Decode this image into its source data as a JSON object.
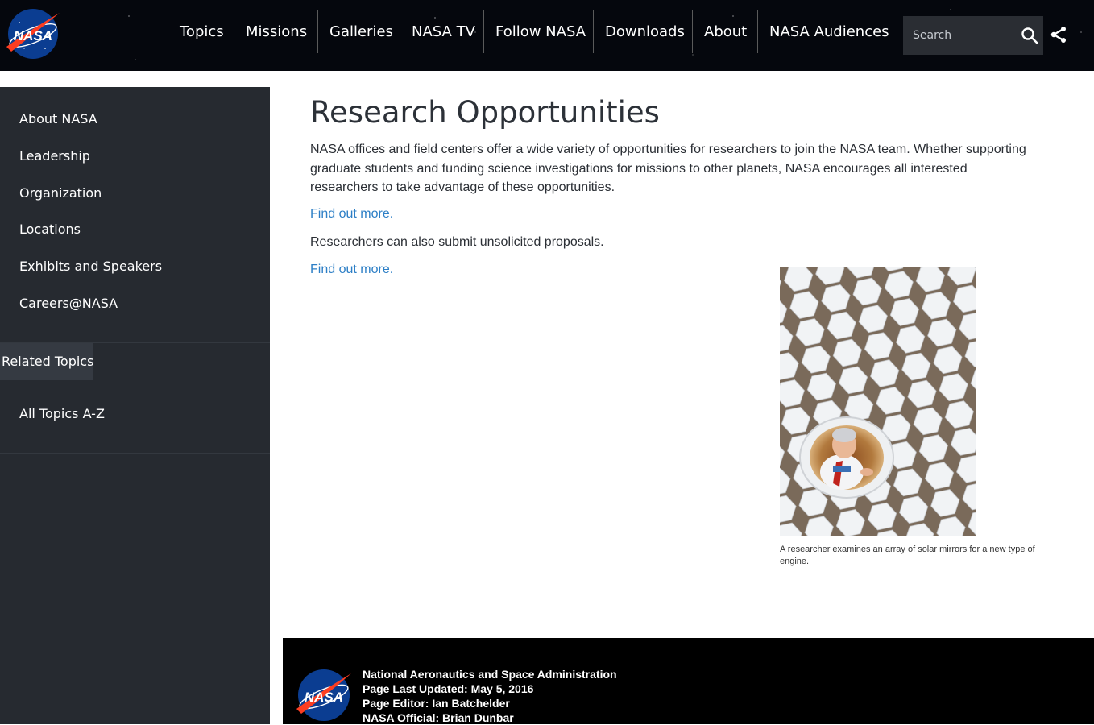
{
  "header": {
    "logo_text": "NASA",
    "nav": [
      {
        "label": "Topics"
      },
      {
        "label": "Missions"
      },
      {
        "label": "Galleries"
      },
      {
        "label": "NASA TV"
      },
      {
        "label": "Follow NASA"
      },
      {
        "label": "Downloads"
      },
      {
        "label": "About"
      },
      {
        "label": "NASA Audiences"
      }
    ],
    "search": {
      "placeholder": "Search",
      "icon": "search-icon"
    },
    "share_icon": "share-icon"
  },
  "sidebar": {
    "items": [
      {
        "label": "About NASA"
      },
      {
        "label": "Leadership"
      },
      {
        "label": "Organization"
      },
      {
        "label": "Locations"
      },
      {
        "label": "Exhibits and Speakers"
      },
      {
        "label": "Careers@NASA"
      }
    ],
    "related": {
      "title": "Related Topics",
      "items": [
        {
          "label": "All Topics A-Z"
        }
      ]
    }
  },
  "main": {
    "title": "Research Opportunities",
    "intro": "NASA offices and field centers offer a wide variety of opportunities for researchers to join the NASA team. Whether supporting graduate students and funding science investigations for missions to other planets, NASA encourages all interested researchers to take advantage of these opportunities.",
    "link1": "Find out more.",
    "unsolicited": "Researchers can also submit unsolicited proposals.",
    "link2": "Find out more.",
    "image_caption": "A researcher examines an array of solar mirrors for a new type of engine."
  },
  "footer": {
    "logo_text": "NASA",
    "org": "National Aeronautics and Space Administration",
    "updated": "Page Last Updated: May 5, 2016",
    "editor": "Page Editor: Ian Batchelder",
    "official": "NASA Official: Brian Dunbar"
  },
  "colors": {
    "nav_bg": "#05070d",
    "sidebar_bg": "#262a30",
    "link": "#2d7fc6",
    "footer_bg": "#000000",
    "meatball_blue": "#0b3d91",
    "meatball_red": "#fc3d21"
  }
}
